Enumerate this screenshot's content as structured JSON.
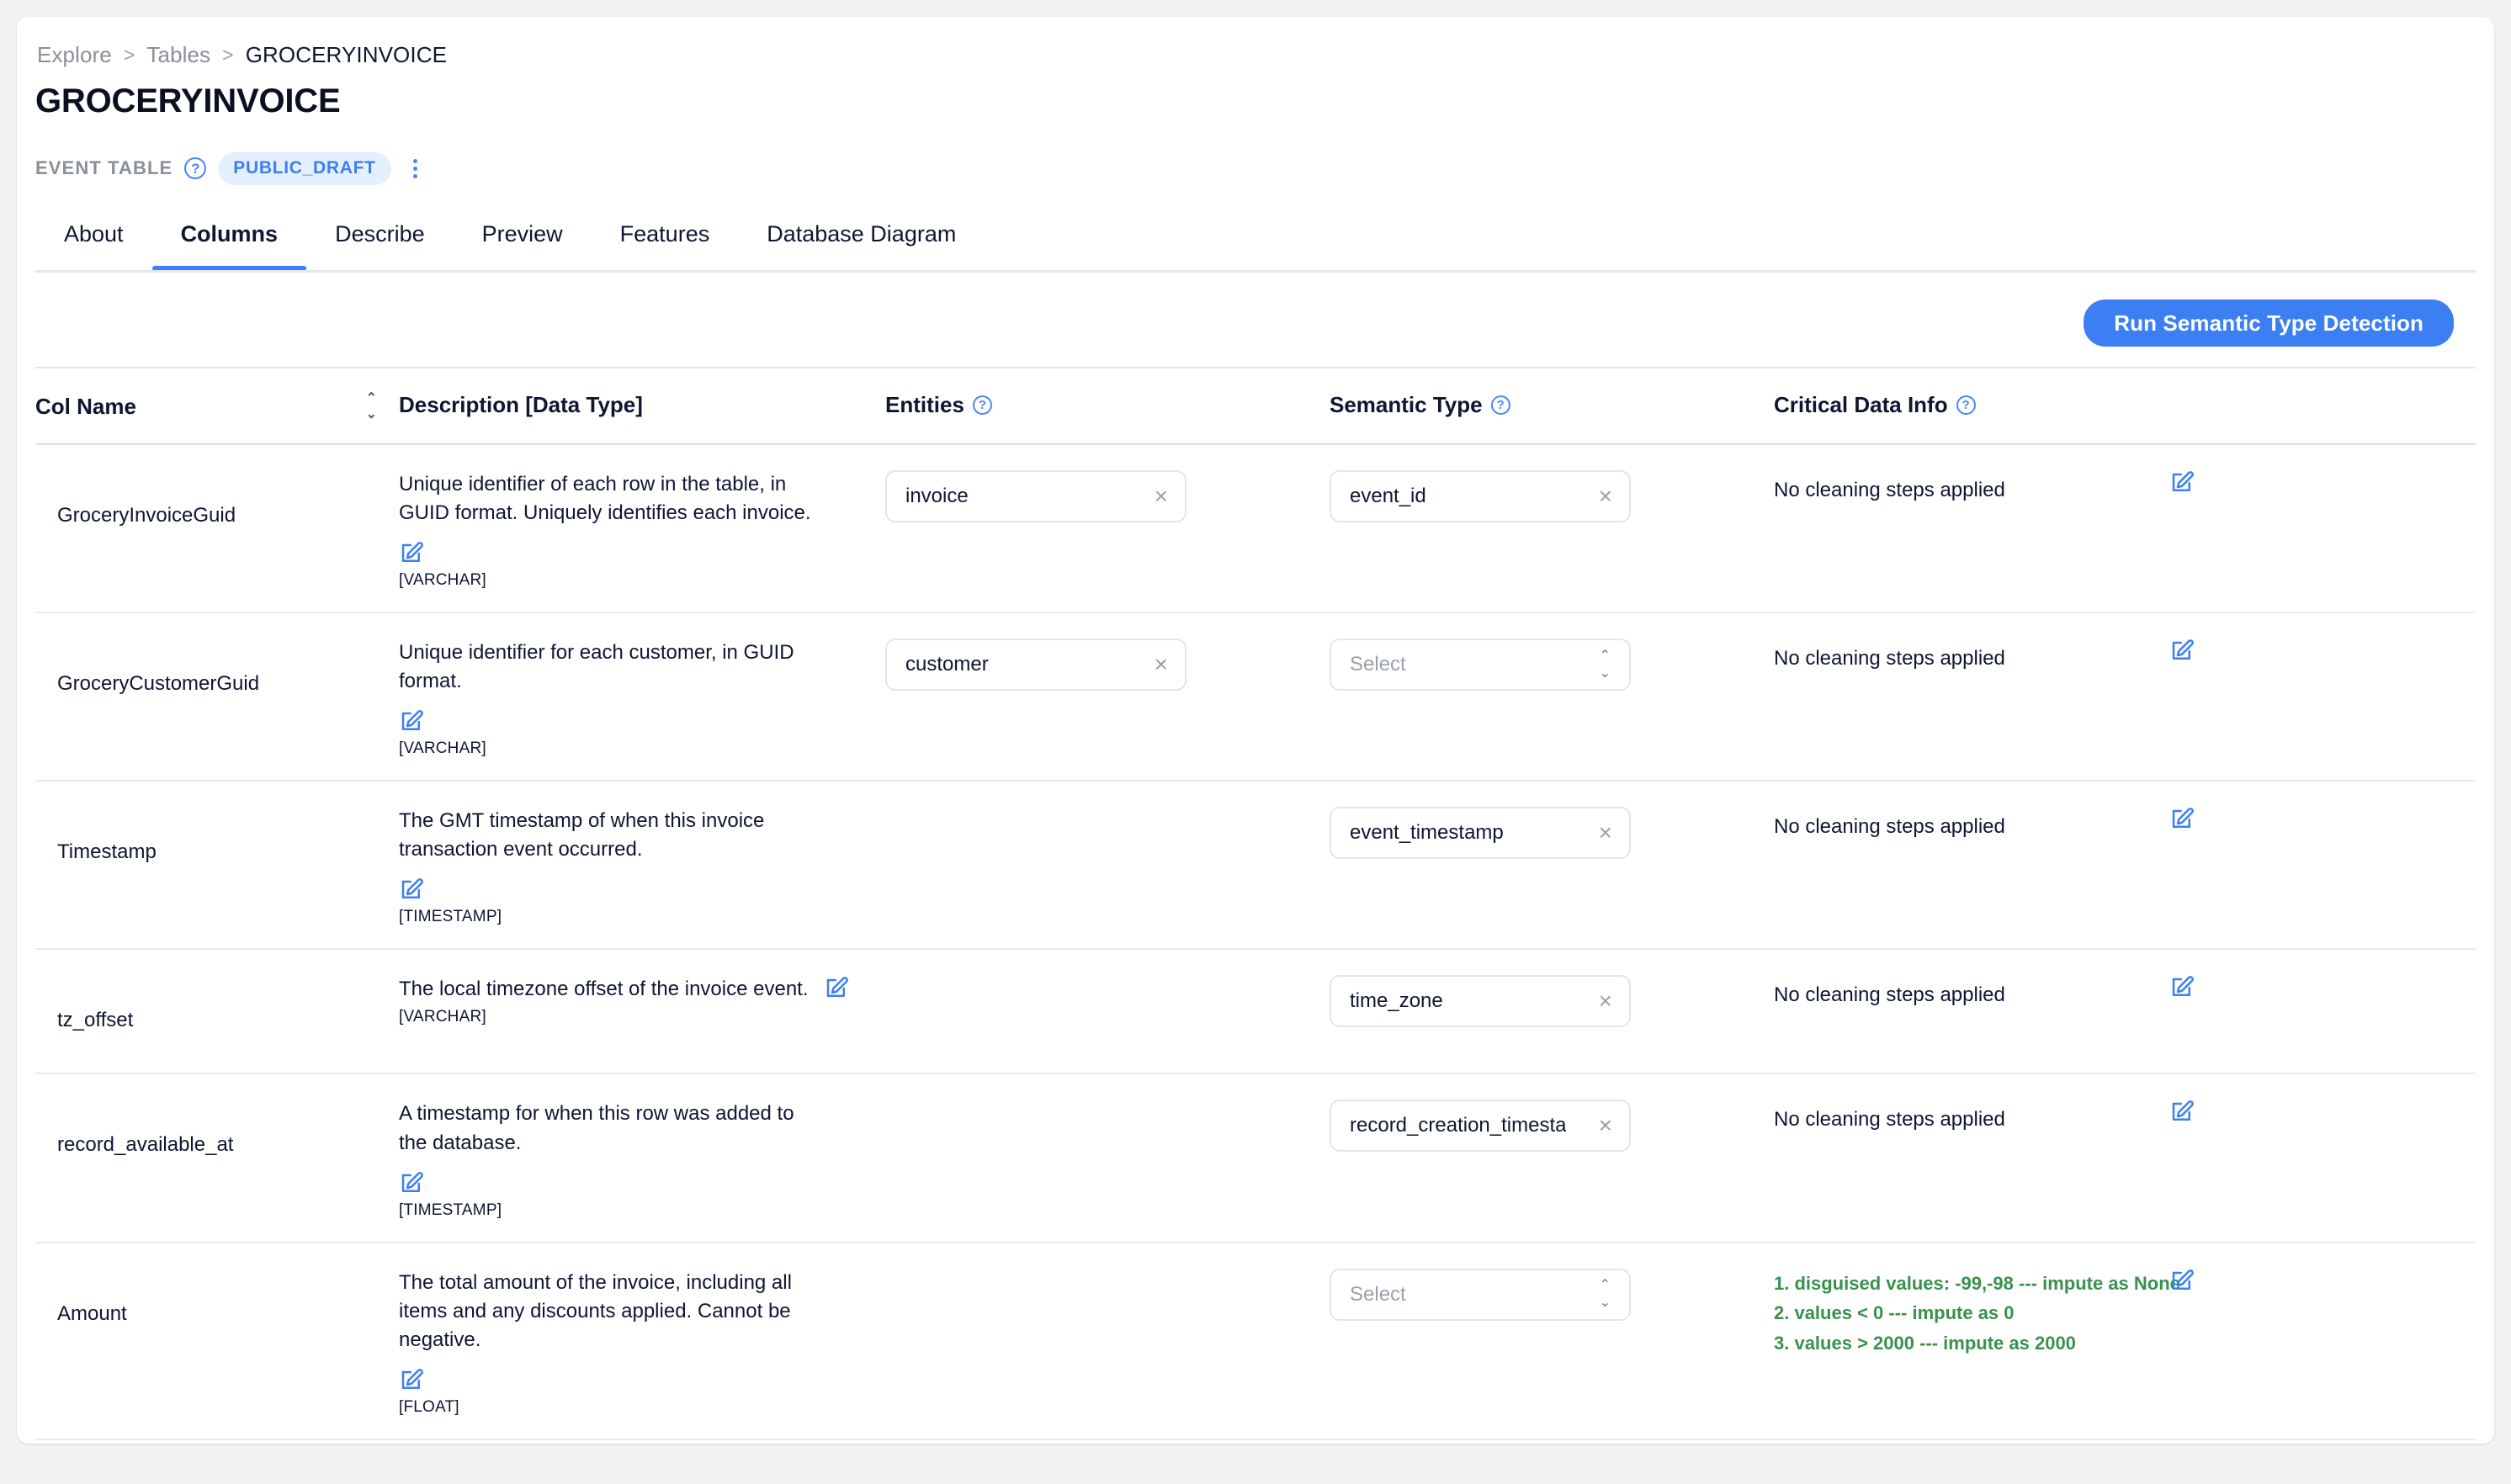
{
  "breadcrumb": {
    "items": [
      "Explore",
      "Tables",
      "GROCERYINVOICE"
    ],
    "separator": ">"
  },
  "header": {
    "title": "GROCERYINVOICE",
    "meta_label": "EVENT TABLE",
    "badge": "PUBLIC_DRAFT",
    "help_glyph": "?",
    "accent_color": "#3b7ff2",
    "badge_bg": "#e4efff"
  },
  "tabs": [
    {
      "label": "About",
      "active": false
    },
    {
      "label": "Columns",
      "active": true
    },
    {
      "label": "Describe",
      "active": false
    },
    {
      "label": "Preview",
      "active": false
    },
    {
      "label": "Features",
      "active": false
    },
    {
      "label": "Database Diagram",
      "active": false
    }
  ],
  "toolbar": {
    "run_detection_label": "Run Semantic Type Detection"
  },
  "table": {
    "headers": {
      "col_name": "Col Name",
      "description": "Description [Data Type]",
      "entities": "Entities",
      "semantic_type": "Semantic Type",
      "critical_data_info": "Critical Data Info"
    },
    "select_placeholder": "Select",
    "no_cleaning_text": "No cleaning steps applied",
    "rows": [
      {
        "col_name": "GroceryInvoiceGuid",
        "description": "Unique identifier of each row in the table, in GUID format. Uniquely identifies each invoice.",
        "data_type": "[VARCHAR]",
        "desc_icon_inline": false,
        "entity": "invoice",
        "semantic_type": "event_id",
        "critical_info": "No cleaning steps applied",
        "critical_rules": []
      },
      {
        "col_name": "GroceryCustomerGuid",
        "description": "Unique identifier for each customer, in GUID format.",
        "data_type": "[VARCHAR]",
        "desc_icon_inline": false,
        "entity": "customer",
        "semantic_type": null,
        "critical_info": "No cleaning steps applied",
        "critical_rules": []
      },
      {
        "col_name": "Timestamp",
        "description": "The GMT timestamp of when this invoice transaction event occurred.",
        "data_type": "[TIMESTAMP]",
        "desc_icon_inline": false,
        "entity": null,
        "semantic_type": "event_timestamp",
        "critical_info": "No cleaning steps applied",
        "critical_rules": []
      },
      {
        "col_name": "tz_offset",
        "description": "The local timezone offset of the invoice event.",
        "data_type": "[VARCHAR]",
        "desc_icon_inline": true,
        "entity": null,
        "semantic_type": "time_zone",
        "critical_info": "No cleaning steps applied",
        "critical_rules": []
      },
      {
        "col_name": "record_available_at",
        "description": "A timestamp for when this row was added to the database.",
        "data_type": "[TIMESTAMP]",
        "desc_icon_inline": false,
        "entity": null,
        "semantic_type": "record_creation_timesta",
        "critical_info": "No cleaning steps applied",
        "critical_rules": []
      },
      {
        "col_name": "Amount",
        "description": "The total amount of the invoice, including all items and any discounts applied. Cannot be negative.",
        "data_type": "[FLOAT]",
        "desc_icon_inline": false,
        "entity": null,
        "semantic_type": null,
        "critical_info": null,
        "critical_rules": [
          "1. disguised values: -99,-98 --- impute as None",
          "2. values < 0 --- impute as 0",
          "3. values > 2000 --- impute as 2000"
        ]
      }
    ]
  },
  "icons": {
    "edit": "edit-pencil-icon",
    "remove": "×",
    "chevron_up": "⌃",
    "chevron_down": "⌄",
    "sort_up": "⌃",
    "sort_down": "⌄"
  }
}
